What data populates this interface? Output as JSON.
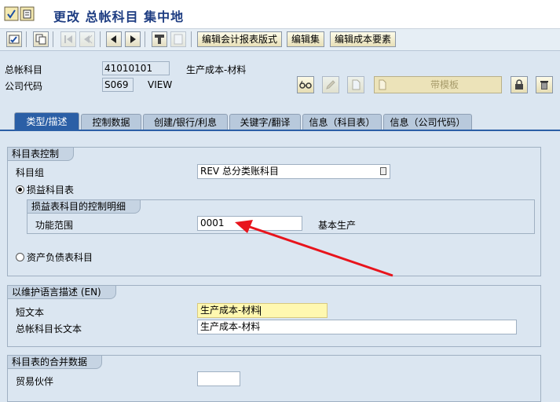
{
  "window": {
    "title": "更改 总帐科目 集中地"
  },
  "toolbar": {
    "buttons": [
      {
        "icon": "display-change-icon"
      },
      {
        "icon": "other-object-icon"
      },
      {
        "icon": "previous-icon"
      },
      {
        "icon": "next-icon"
      },
      {
        "icon": "first-page-icon"
      },
      {
        "icon": "last-page-icon"
      },
      {
        "icon": "where-used-icon"
      },
      {
        "icon": "document-icon"
      }
    ],
    "edit_fs_variant": "编辑会计报表版式",
    "edit_set": "编辑集",
    "edit_cost_element": "编辑成本要素"
  },
  "header": {
    "gl_account_label": "总帐科目",
    "gl_account_value": "41010101",
    "gl_account_desc": "生产成本-材料",
    "company_code_label": "公司代码",
    "company_code_value": "S069",
    "company_code_desc": "VIEW",
    "with_template": "带模板"
  },
  "tabs": [
    {
      "label": "类型/描述",
      "active": true
    },
    {
      "label": "控制数据"
    },
    {
      "label": "创建/银行/利息"
    },
    {
      "label": "关键字/翻译"
    },
    {
      "label": "信息（科目表）"
    },
    {
      "label": "信息（公司代码）"
    }
  ],
  "coa_control": {
    "title": "科目表控制",
    "account_group_label": "科目组",
    "account_group_value": "REV 总分类账科目",
    "pl_account_label": "损益科目表",
    "pl_detail": {
      "title": "损益表科目的控制明细",
      "functional_area_label": "功能范围",
      "functional_area_value": "0001",
      "functional_area_desc": "基本生产"
    },
    "bs_account_label": "资产负债表科目"
  },
  "description": {
    "title": "以维护语言描述 (EN)",
    "short_text_label": "短文本",
    "short_text_value": "生产成本-材料",
    "long_text_label": "总帐科目长文本",
    "long_text_value": "生产成本-材料"
  },
  "consolidation": {
    "title": "科目表的合并数据",
    "trading_partner_label": "贸易伙伴",
    "trading_partner_value": ""
  },
  "annotation": {
    "color": "#e8141c"
  }
}
